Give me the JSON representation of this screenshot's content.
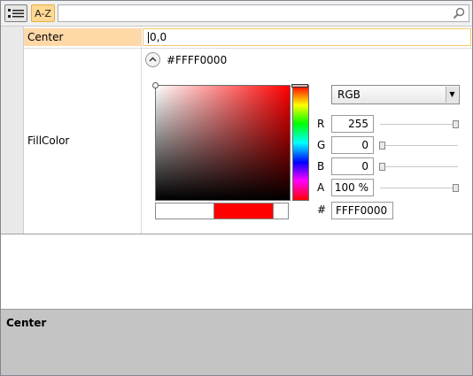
{
  "toolbar": {
    "categorized_icon": "categorized-list-icon",
    "alphabetical_label": "A-Z",
    "search": {
      "value": "",
      "placeholder": "",
      "icon": "search-icon"
    }
  },
  "properties": [
    {
      "name": "Center",
      "value": "0,0",
      "selected": true
    },
    {
      "name": "FillColor",
      "value": "#FFFF0000"
    }
  ],
  "color_editor": {
    "collapse_icon": "chevron-up-icon",
    "hex_display": "#FFFF0000",
    "mode": "RGB",
    "channels": [
      {
        "label": "R",
        "value": "255",
        "level": 1.0
      },
      {
        "label": "G",
        "value": "0",
        "level": 0.0
      },
      {
        "label": "B",
        "value": "0",
        "level": 0.0
      },
      {
        "label": "A",
        "value": "100 %",
        "level": 1.0
      }
    ],
    "hex_label": "#",
    "hex_value": "FFFF0000",
    "current_color": "#ff0000"
  },
  "description": {
    "title": "Center"
  },
  "colors": {
    "selection": "#ffd8a8",
    "accent_border": "#f4c76f",
    "description_bg": "#c4c4c4"
  }
}
